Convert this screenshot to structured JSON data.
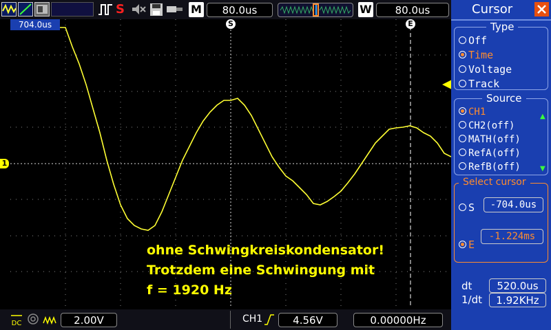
{
  "top": {
    "timebase_label": "M",
    "timebase_value": "80.0us",
    "window_label": "W",
    "window_value": "80.0us"
  },
  "screen": {
    "cursor_s_marker": "S",
    "cursor_e_marker": "E",
    "s_time_tag": "704.0us",
    "ch1_marker": "1",
    "annotation": [
      "ohne Schwingkreiskondensator!",
      "Trotzdem eine Schwingung mit",
      "f = 1920 Hz"
    ]
  },
  "bottom": {
    "volts_div": "2.00V",
    "trigger_source": "CH1",
    "trigger_level": "4.56V",
    "frequency": "0.00000Hz"
  },
  "panel": {
    "title": "Cursor",
    "type_legend": "Type",
    "type_options": [
      "Off",
      "Time",
      "Voltage",
      "Track"
    ],
    "type_selected": 1,
    "source_legend": "Source",
    "source_options": [
      "CH1",
      "CH2(off)",
      "MATH(off)",
      "RefA(off)",
      "RefB(off)"
    ],
    "source_selected": 0,
    "select_legend": "Select cursor",
    "s_label": "S",
    "s_value": "-704.0us",
    "e_label": "E",
    "e_value": "-1.224ms",
    "dt_label": "dt",
    "dt_value": "520.0us",
    "inv_dt_label": "1/dt",
    "inv_dt_value": "1.92KHz"
  },
  "colors": {
    "trace": "#ffff33",
    "panel_bg": "#1a3fb0",
    "selected": "#ff8c2e"
  }
}
